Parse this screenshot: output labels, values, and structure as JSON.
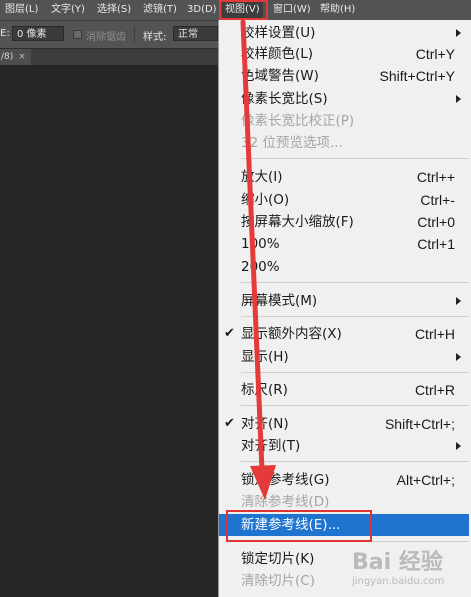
{
  "menubar": {
    "items": [
      {
        "label": "图层(L)"
      },
      {
        "label": "文字(Y)"
      },
      {
        "label": "选择(S)"
      },
      {
        "label": "滤镜(T)"
      },
      {
        "label": "3D(D)"
      },
      {
        "label": "视图(V)"
      },
      {
        "label": "窗口(W)"
      },
      {
        "label": "帮助(H)"
      }
    ],
    "active": "视图(V)"
  },
  "options": {
    "feather_label": "E:",
    "feather_value": "0 像素",
    "antialias_label": "消除锯齿",
    "style_label": "样式:",
    "style_value": "正常"
  },
  "document_tab": {
    "label": "/8)",
    "close": "×"
  },
  "view_menu": {
    "items": [
      {
        "label": "校样设置(U)",
        "shortcut": "",
        "submenu": true,
        "disabled": false,
        "checked": false
      },
      {
        "label": "校样颜色(L)",
        "shortcut": "Ctrl+Y"
      },
      {
        "label": "色域警告(W)",
        "shortcut": "Shift+Ctrl+Y"
      },
      {
        "label": "像素长宽比(S)",
        "shortcut": "",
        "submenu": true
      },
      {
        "label": "像素长宽比校正(P)",
        "shortcut": "",
        "disabled": true
      },
      {
        "label": "32 位预览选项...",
        "shortcut": "",
        "disabled": true
      },
      {
        "label": "放大(I)",
        "shortcut": "Ctrl++"
      },
      {
        "label": "缩小(O)",
        "shortcut": "Ctrl+-"
      },
      {
        "label": "按屏幕大小缩放(F)",
        "shortcut": "Ctrl+0"
      },
      {
        "label": "100%",
        "shortcut": "Ctrl+1"
      },
      {
        "label": "200%",
        "shortcut": ""
      },
      {
        "label": "屏幕模式(M)",
        "shortcut": "",
        "submenu": true
      },
      {
        "label": "显示额外内容(X)",
        "shortcut": "Ctrl+H",
        "checked": true
      },
      {
        "label": "显示(H)",
        "shortcut": "",
        "submenu": true
      },
      {
        "label": "标尺(R)",
        "shortcut": "Ctrl+R"
      },
      {
        "label": "对齐(N)",
        "shortcut": "Shift+Ctrl+;",
        "checked": true
      },
      {
        "label": "对齐到(T)",
        "shortcut": "",
        "submenu": true
      },
      {
        "label": "锁定参考线(G)",
        "shortcut": "Alt+Ctrl+;"
      },
      {
        "label": "清除参考线(D)",
        "shortcut": "",
        "disabled": true
      },
      {
        "label": "新建参考线(E)...",
        "shortcut": "",
        "highlighted": true
      },
      {
        "label": "锁定切片(K)",
        "shortcut": ""
      },
      {
        "label": "清除切片(C)",
        "shortcut": "",
        "disabled": true
      }
    ],
    "check_glyph": "✔"
  },
  "watermark": {
    "text": "Bai 经验",
    "sub": "jingyan.baidu.com"
  },
  "colors": {
    "menubar_bg": "#535353",
    "canvas_bg": "#262626",
    "menu_bg": "#f0f0f0",
    "highlight": "#1e74cf",
    "annotation_red": "#dd3333"
  }
}
